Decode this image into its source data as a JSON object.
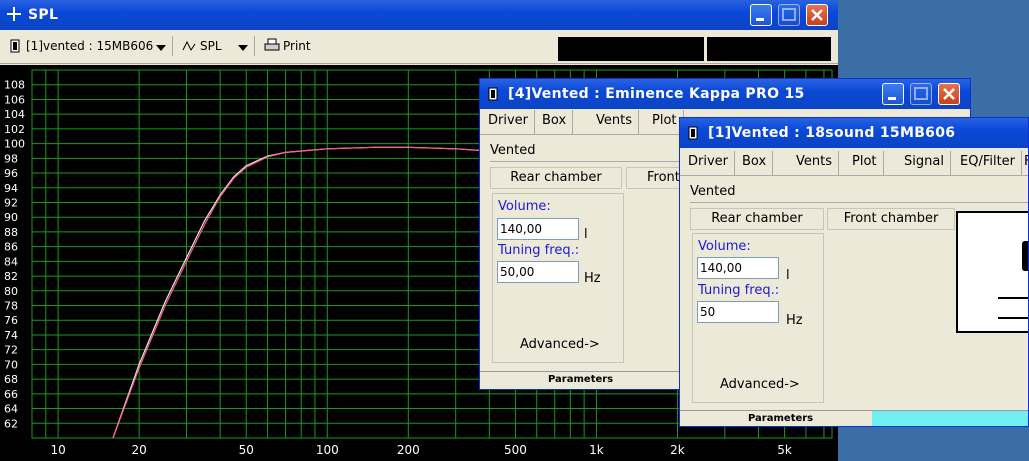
{
  "spl_window": {
    "title": "SPL",
    "toolbar": {
      "driver_label": "[1]vented : 15MB606",
      "mode_label": "SPL",
      "print_label": "Print"
    },
    "chart_data": {
      "type": "line",
      "x_scale": "log",
      "xlim": [
        8,
        7500
      ],
      "ylim": [
        60,
        110
      ],
      "y_ticks": [
        62,
        64,
        66,
        68,
        70,
        72,
        74,
        76,
        78,
        80,
        82,
        84,
        86,
        88,
        90,
        92,
        94,
        96,
        98,
        100,
        102,
        104,
        106,
        108
      ],
      "x_ticks": [
        {
          "v": 10,
          "label": "10"
        },
        {
          "v": 20,
          "label": "20"
        },
        {
          "v": 50,
          "label": "50"
        },
        {
          "v": 100,
          "label": "100"
        },
        {
          "v": 200,
          "label": "200"
        },
        {
          "v": 500,
          "label": "500"
        },
        {
          "v": 1000,
          "label": "1k"
        },
        {
          "v": 2000,
          "label": "2k"
        },
        {
          "v": 5000,
          "label": "5k"
        }
      ],
      "grid": true,
      "series": [
        {
          "color": "#e8e8e8",
          "points": [
            [
              16,
              60
            ],
            [
              20,
              70
            ],
            [
              25,
              78.5
            ],
            [
              30,
              84.5
            ],
            [
              35,
              89.5
            ],
            [
              40,
              93
            ],
            [
              45,
              95.5
            ],
            [
              50,
              97
            ],
            [
              60,
              98.3
            ],
            [
              70,
              98.8
            ],
            [
              80,
              99
            ],
            [
              100,
              99.3
            ],
            [
              150,
              99.5
            ],
            [
              200,
              99.5
            ],
            [
              300,
              99.3
            ],
            [
              400,
              99
            ],
            [
              500,
              98.6
            ],
            [
              600,
              98.2
            ]
          ]
        },
        {
          "color": "#ff5a8c",
          "points": [
            [
              16,
              60
            ],
            [
              20,
              69.5
            ],
            [
              25,
              78
            ],
            [
              30,
              84
            ],
            [
              35,
              89
            ],
            [
              40,
              92.8
            ],
            [
              45,
              95.3
            ],
            [
              50,
              96.8
            ],
            [
              60,
              98.2
            ],
            [
              70,
              98.8
            ],
            [
              80,
              99
            ],
            [
              100,
              99.3
            ],
            [
              150,
              99.5
            ],
            [
              200,
              99.5
            ],
            [
              300,
              99.3
            ],
            [
              400,
              99
            ],
            [
              500,
              98.6
            ],
            [
              600,
              98.2
            ]
          ]
        }
      ]
    }
  },
  "win_kappa": {
    "title": "[4]Vented : Eminence  Kappa PRO 15",
    "tabs": [
      "Driver",
      "Box",
      "Vents",
      "Plot"
    ],
    "box_type": "Vented",
    "rear_chamber_label": "Rear chamber",
    "front_chamber_label": "Front",
    "volume_label": "Volume:",
    "volume_value": "140,00",
    "volume_unit": "l",
    "tuning_label": "Tuning freq.:",
    "tuning_value": "50,00",
    "tuning_unit": "Hz",
    "advanced_label": "Advanced->",
    "status_label": "Parameters"
  },
  "win_18sound": {
    "title": "[1]Vented : 18sound 15MB606",
    "tabs": [
      "Driver",
      "Box",
      "Vents",
      "Plot",
      "Signal",
      "EQ/Filter",
      "F"
    ],
    "box_type": "Vented",
    "rear_chamber_label": "Rear chamber",
    "front_chamber_label": "Front chamber",
    "volume_label": "Volume:",
    "volume_value": "140,00",
    "volume_unit": "l",
    "tuning_label": "Tuning freq.:",
    "tuning_value": "50",
    "tuning_unit": "Hz",
    "advanced_label": "Advanced->",
    "status_label": "Parameters"
  }
}
